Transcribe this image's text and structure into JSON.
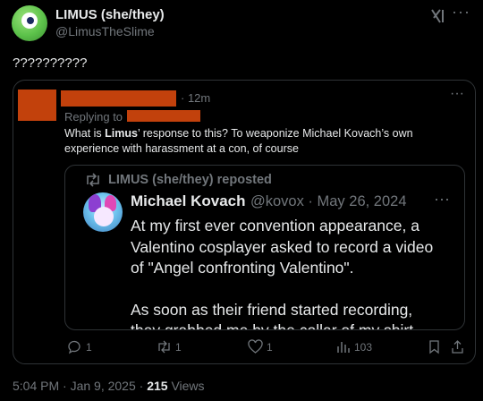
{
  "author": {
    "name": "LIMUS (she/they)",
    "handle": "@LimusTheSlime"
  },
  "tweet": {
    "text": "??????????"
  },
  "quote": {
    "time": "· 12m",
    "replying_label": "Replying to",
    "body_prefix": "What is ",
    "body_bold": "Limus",
    "body_suffix": "’ response to this? To weaponize Michael Kovach’s own experience with harassment at a con, of course",
    "more": "···",
    "inner": {
      "repost_label": "LIMUS (she/they) reposted",
      "name": "Michael Kovach",
      "handle_date": "@kovox · May 26, 2024",
      "more": "···",
      "paragraphs": [
        "At my first ever convention appearance, a\nValentino cosplayer asked to record a video\nof \"Angel confronting Valentino\".",
        "As soon as their friend started recording,\nthey grabbed me by the collar of my shirt"
      ]
    },
    "actions": {
      "replies": "1",
      "reposts": "1",
      "likes": "1",
      "views": "103"
    }
  },
  "footer": {
    "time": "5:04 PM · Jan 9, 2025 · ",
    "views_count": "215",
    "views_label": " Views"
  },
  "colors": {
    "redaction": "#c2410c",
    "muted": "#71767b",
    "text": "#e7e9ea",
    "border": "#2f3336"
  }
}
